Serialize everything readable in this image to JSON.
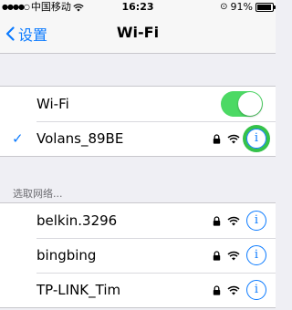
{
  "status": {
    "carrier": "中国移动",
    "time": "16:23",
    "battery_percent": "91%",
    "battery_level": 0.91
  },
  "nav": {
    "back_label": "设置",
    "title": "Wi-Fi"
  },
  "wifi_toggle": {
    "label": "Wi-Fi",
    "on": true
  },
  "connected": {
    "name": "Volans_89BE"
  },
  "section_header": "选取网络...",
  "networks": [
    {
      "name": "belkin.3296"
    },
    {
      "name": "bingbing"
    },
    {
      "name": "TP-LINK_Tim"
    }
  ],
  "colors": {
    "accent": "#0a7aff",
    "toggle_on": "#4cd964",
    "highlight": "#35c24a"
  }
}
